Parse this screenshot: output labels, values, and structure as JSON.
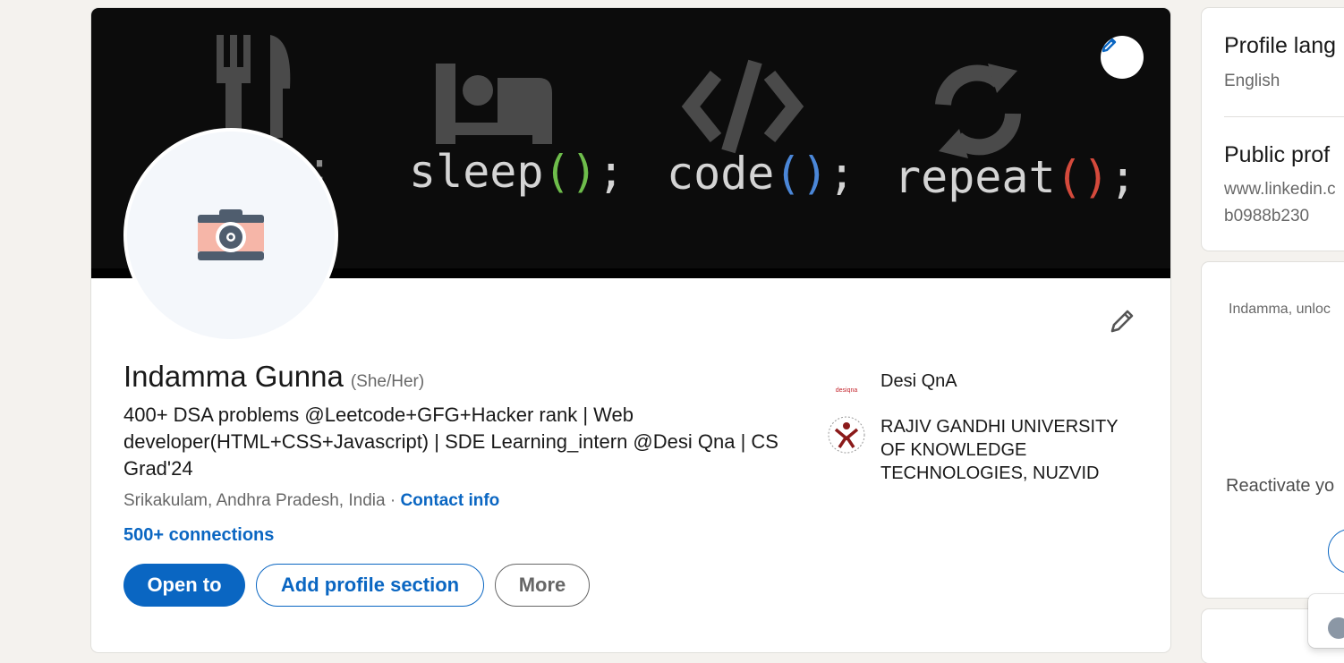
{
  "banner": {
    "words": [
      "sleep",
      "code",
      "repeat"
    ],
    "icons": [
      "fork-knife-icon",
      "bed-icon",
      "code-brackets-icon",
      "refresh-icon"
    ],
    "paren_colors": [
      "#6ebd4b",
      "#4b87d8",
      "#d54a3c"
    ],
    "edit_icon": "pencil-icon"
  },
  "profile": {
    "name": "Indamma Gunna",
    "pronouns": "(She/Her)",
    "headline": "400+ DSA problems @Leetcode+GFG+Hacker rank | Web developer(HTML+CSS+Javascript) | SDE Learning_intern @Desi Qna | CS Grad'24",
    "location": "Srikakulam, Andhra Pradesh, India",
    "separator": "·",
    "contact_info": "Contact info",
    "connections": "500+ connections"
  },
  "actions": {
    "open_to": "Open to",
    "add_section": "Add profile section",
    "more": "More"
  },
  "experience": [
    {
      "logo_text": "desiqna",
      "name": "Desi QnA"
    },
    {
      "name": "RAJIV GANDHI UNIVERSITY OF KNOWLEDGE TECHNOLOGIES, NUZVID"
    }
  ],
  "sidebar": {
    "language_title": "Profile lang",
    "language_value": "English",
    "public_title": "Public prof",
    "public_url_1": "www.linkedin.c",
    "public_url_2": "b0988b230",
    "ad_text": "Indamma, unloc",
    "ad_cta": "Reactivate yo"
  },
  "colors": {
    "accent": "#0a66c2",
    "page_bg": "#f4f2ee",
    "banner_bg": "#0c0c0c"
  }
}
